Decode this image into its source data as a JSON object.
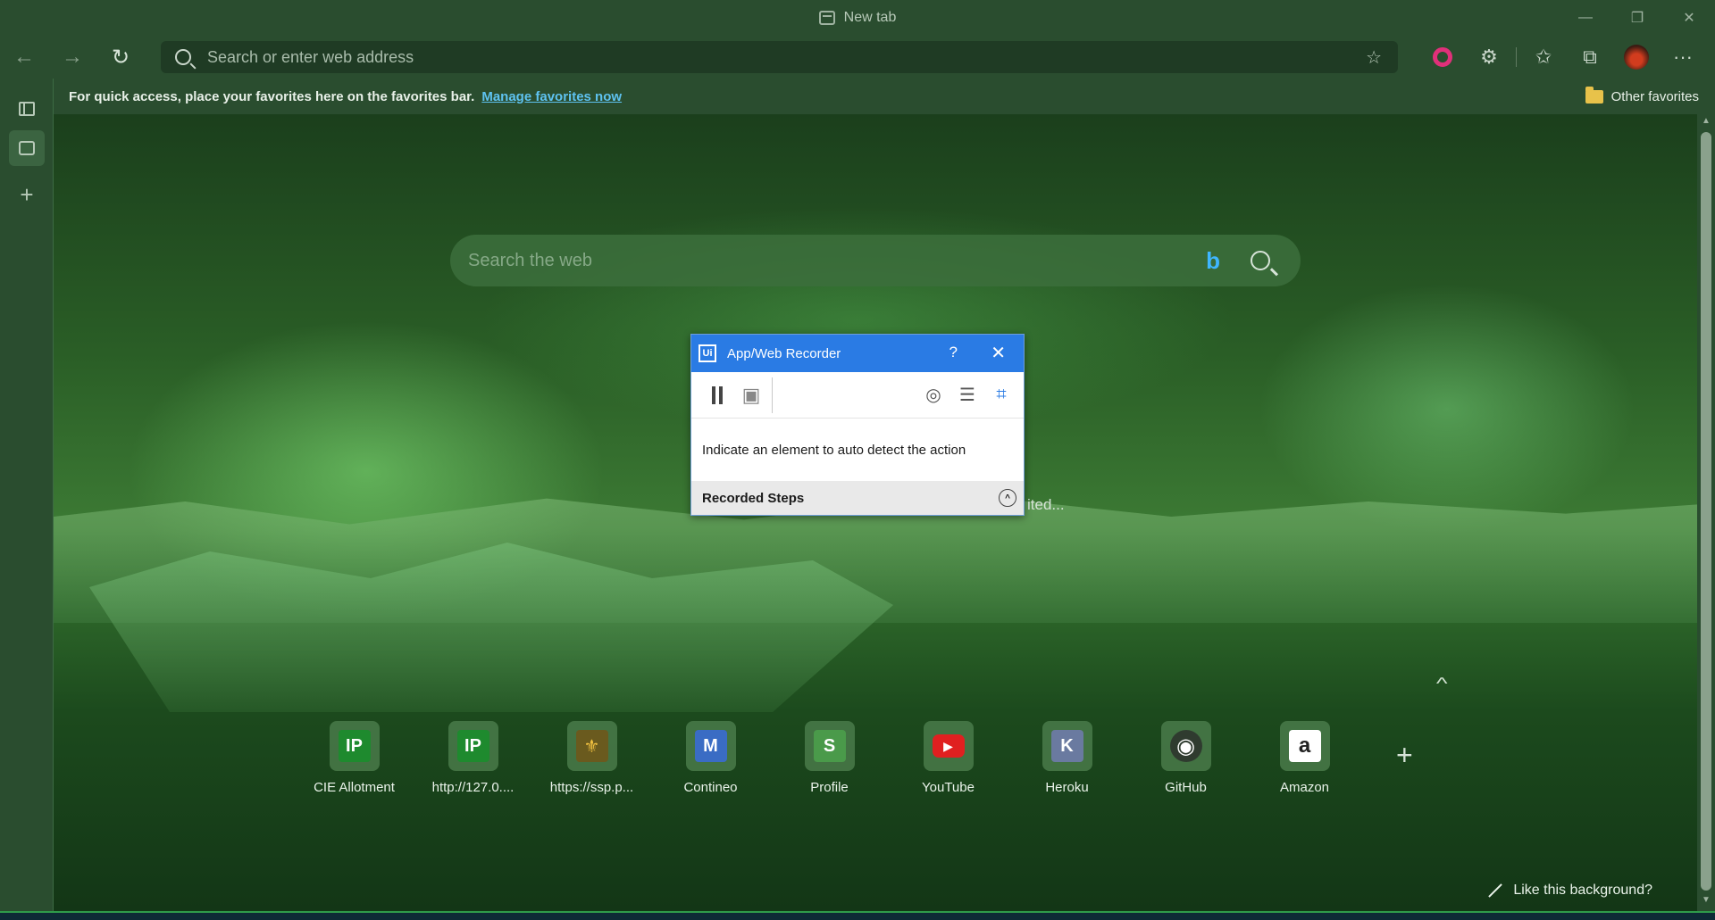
{
  "window": {
    "tab_title": "New tab",
    "controls": {
      "minimize": "—",
      "restore": "❐",
      "close": "✕"
    }
  },
  "toolbar": {
    "back_icon": "←",
    "forward_icon": "→",
    "refresh_icon": "↻",
    "address_placeholder": "Search or enter web address",
    "add_favorite_icon": "☆",
    "extensions_icon": "⚙",
    "favorites_icon": "✩",
    "collections_icon": "⧉",
    "more_icon": "···"
  },
  "favorites_bar": {
    "message": "For quick access, place your favorites here on the favorites bar.",
    "link": "Manage favorites now",
    "other_favorites": "Other favorites"
  },
  "sidebar": {
    "add_tab_icon": "+"
  },
  "newtab": {
    "search_placeholder": "Search the web",
    "bing_glyph": "b",
    "partial_text": "ited...",
    "collapse_icon": "^",
    "add_site_icon": "+",
    "like_background": "Like this background?",
    "top_sites": [
      {
        "label": "CIE Allotment",
        "glyph": "IP",
        "color": "#1e8a2e"
      },
      {
        "label": "http://127.0....",
        "glyph": "IP",
        "color": "#1e8a2e"
      },
      {
        "label": "https://ssp.p...",
        "glyph": "⚜",
        "color": "#6a5a1e"
      },
      {
        "label": "Contineo",
        "glyph": "M",
        "color": "#3a6cc4"
      },
      {
        "label": "Profile",
        "glyph": "S",
        "color": "#4a9a4a"
      },
      {
        "label": "YouTube",
        "glyph": "▶",
        "color": "#e02020"
      },
      {
        "label": "Heroku",
        "glyph": "K",
        "color": "#6a7aa0"
      },
      {
        "label": "GitHub",
        "glyph": "◉",
        "color": "#2f3b2f"
      },
      {
        "label": "Amazon",
        "glyph": "a",
        "color": "#222222"
      }
    ]
  },
  "recorder": {
    "logo": "Ui",
    "title": "App/Web Recorder",
    "help": "?",
    "close": "✕",
    "save_icon": "▣",
    "detect_icon": "◎",
    "steps_icon": "☰",
    "screen_icon": "⌗",
    "message": "Indicate an element to auto detect the action",
    "steps_header": "Recorded Steps",
    "collapse_glyph": "^"
  },
  "scrollbar": {
    "up": "▲",
    "down": "▼"
  }
}
